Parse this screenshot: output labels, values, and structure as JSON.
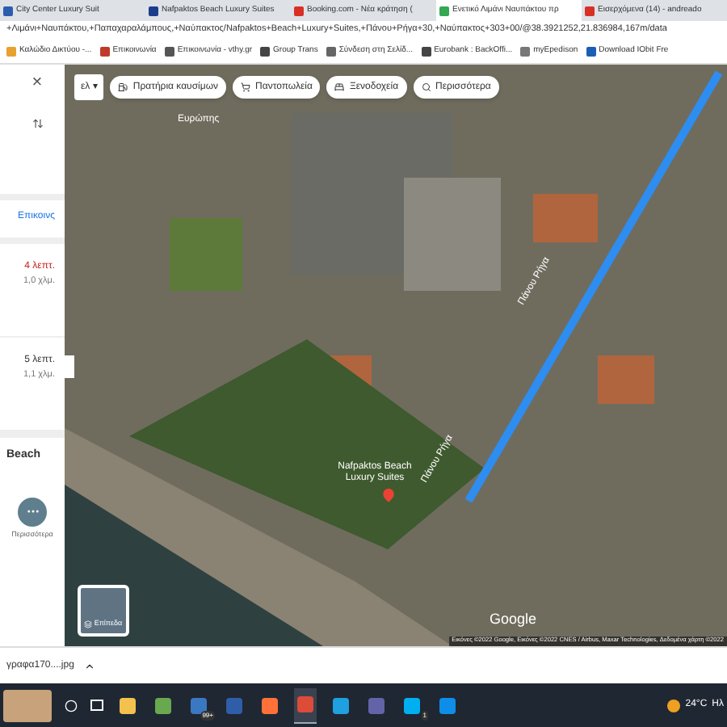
{
  "browser": {
    "tabs": [
      {
        "title": "City Center Luxury Suit",
        "selected": false,
        "kind": "hotel"
      },
      {
        "title": "Nafpaktos Beach Luxury Suites",
        "selected": false,
        "kind": "booking"
      },
      {
        "title": "Booking.com - Νέα κράτηση (",
        "selected": false,
        "kind": "mail"
      },
      {
        "title": "Ενετικό Λιμάνι Ναυπάκτου πρ",
        "selected": true,
        "kind": "maps"
      },
      {
        "title": "Εισερχόμενα (14) - andreado",
        "selected": false,
        "kind": "mail"
      }
    ],
    "address": "+Λιμάνι+Ναυπάκτου,+Παπαχαραλάμπους,+Ναύπακτος/Nafpaktos+Beach+Luxury+Suites,+Πάνου+Ρήγα+30,+Ναύπακτος+303+00/@38.3921252,21.836984,167m/data",
    "bookmarks": [
      {
        "label": "Καλώδιο Δικτύου -...",
        "color": "#e8a030"
      },
      {
        "label": "Επικοινωνία",
        "color": "#c0392b"
      },
      {
        "label": "Επικοινωνία - vthy.gr",
        "color": "#555555"
      },
      {
        "label": "Group Trans",
        "color": "#444444"
      },
      {
        "label": "Σύνδεση στη Σελίδ...",
        "color": "#666666"
      },
      {
        "label": "Eurobank : BackOffi...",
        "color": "#444444"
      },
      {
        "label": "myEpedison",
        "color": "#777777"
      },
      {
        "label": "Download IObit Fre",
        "color": "#1a5fb4"
      }
    ]
  },
  "panel": {
    "close": "×",
    "contact": "Επικοινς",
    "routes": [
      {
        "time": "4 λεπτ.",
        "distance": "1,0 χλμ.",
        "fastest": true
      },
      {
        "time": "5 λεπτ.",
        "distance": "1,1 χλμ.",
        "fastest": false
      }
    ],
    "place": "Beach",
    "more": "Περισσότερα"
  },
  "map": {
    "language": "ελ",
    "language_caret": "▾",
    "chips": [
      {
        "label": "Πρατήρια καυσίμων",
        "kind": "fuel"
      },
      {
        "label": "Παντοπωλεία",
        "kind": "cart"
      },
      {
        "label": "Ξενοδοχεία",
        "kind": "bed"
      },
      {
        "label": "Περισσότερα",
        "kind": "search"
      }
    ],
    "streets": [
      "Ευρώπης",
      "Πάνου Ρήγα",
      "Πάνου Ρήγα"
    ],
    "place_label": "Nafpaktos Beach Luxury Suites",
    "layers": "Επίπεδα",
    "logo": "Google",
    "attribution": "Εικόνες ©2022 Google, Εικόνες ©2022 CNES / Airbus, Maxar Technologies, Δεδομένα χάρτη ©2022"
  },
  "download": {
    "file": "γραφα170....jpg"
  },
  "taskbar": {
    "apps": [
      {
        "kind": "folder",
        "active": false
      },
      {
        "kind": "store",
        "active": false
      },
      {
        "kind": "mail",
        "active": false,
        "badge": "99+"
      },
      {
        "kind": "archive",
        "active": false
      },
      {
        "kind": "firefox",
        "active": false
      },
      {
        "kind": "chrome",
        "active": true
      },
      {
        "kind": "edge",
        "active": false
      },
      {
        "kind": "teams",
        "active": false
      },
      {
        "kind": "skype",
        "active": false,
        "badge": "1"
      },
      {
        "kind": "teamviewer",
        "active": false
      }
    ],
    "temperature": "24°C",
    "weather_text": "Ηλ"
  }
}
